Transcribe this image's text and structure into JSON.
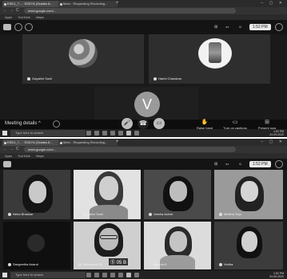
{
  "shot1": {
    "tabs": [
      {
        "label": "ESD1_7... : ESD7A (Grades 8...",
        "active": true
      },
      {
        "label": "Meet - Requesting Recording...",
        "active": false
      }
    ],
    "new_tab_glyph": "+",
    "window_controls": "– ▢ ✕",
    "nav": {
      "back": "←",
      "forward": "→",
      "reload": "C"
    },
    "url": "meet.google.com/...",
    "bookmarks": [
      "Apps",
      "YouTube",
      "Maps"
    ],
    "meet_header": {
      "time": "1:52 PM"
    },
    "participants": [
      {
        "name": "Gayathri Sunil"
      },
      {
        "name": "Harini Chandran"
      }
    ],
    "presenter_initial": "V",
    "bottom": {
      "meeting_details_label": "Meeting details",
      "chevron": "^",
      "controls": [
        {
          "icon": "mic-icon",
          "glyph": "🎤"
        },
        {
          "icon": "hangup-icon",
          "glyph": "☎"
        },
        {
          "icon": "camera-icon",
          "glyph": "▭"
        }
      ],
      "actions": [
        {
          "label": "Raise hand",
          "glyph": "✋"
        },
        {
          "label": "Turn on captions",
          "glyph": "▭"
        },
        {
          "label": "Present now",
          "glyph": "⊞"
        }
      ]
    },
    "taskbar": {
      "search_placeholder": "Type here to search",
      "time": "1:52 PM",
      "date": "24-09-2020"
    }
  },
  "shot2": {
    "tabs": [
      {
        "label": "ESD1_7... : ESD7A (Grades 8...",
        "active": true
      },
      {
        "label": "Meet - Requesting Recording...",
        "active": false
      }
    ],
    "url": "meet.google.com/...",
    "bookmarks": [
      "Apps",
      "YouTube",
      "Maps"
    ],
    "meet_header": {
      "time": "1:52 PM"
    },
    "participants": [
      {
        "name": "Neha Bhaskar"
      },
      {
        "name": "Gayathri Sunil"
      },
      {
        "name": "Varsha Ashok"
      },
      {
        "name": "Mihitha Saju"
      },
      {
        "name": "Sangeetha Anand"
      },
      {
        "name": "Meenakshi M"
      },
      {
        "name": "Aparna K"
      },
      {
        "name": "Vedha"
      }
    ],
    "watermark": "Ⓢ 05  B",
    "taskbar": {
      "search_placeholder": "Type here to search",
      "time": "1:52 PM",
      "date": "24-09-2020"
    }
  }
}
